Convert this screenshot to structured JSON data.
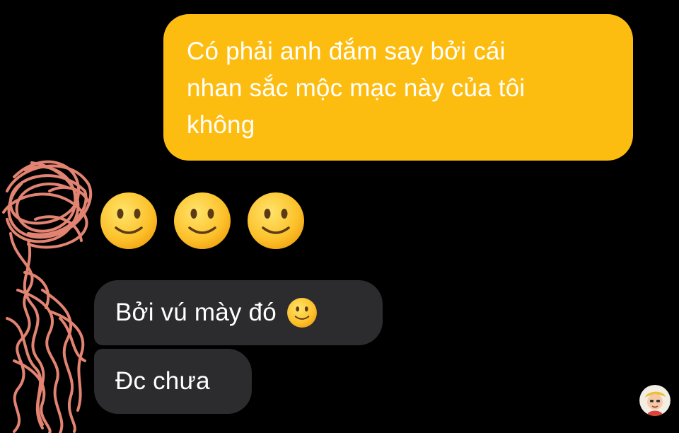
{
  "chat": {
    "outgoing_message": {
      "lines": [
        "Có phải anh đắm say bởi cái",
        "nhan sắc mộc mạc này của tôi",
        "không"
      ]
    },
    "emoji_message": {
      "emojis": [
        "slightly-smiling-face-icon",
        "slightly-smiling-face-icon",
        "slightly-smiling-face-icon"
      ]
    },
    "incoming_messages": [
      {
        "text": "Bởi vú mày đó",
        "emoji": "slightly-smiling-face-icon"
      },
      {
        "text": "Đc chưa"
      }
    ]
  },
  "colors": {
    "background": "#000000",
    "outgoing_bubble": "#fdbd10",
    "incoming_bubble": "#2c2c2e",
    "scribble": "#f08b78",
    "text": "#ffffff"
  }
}
